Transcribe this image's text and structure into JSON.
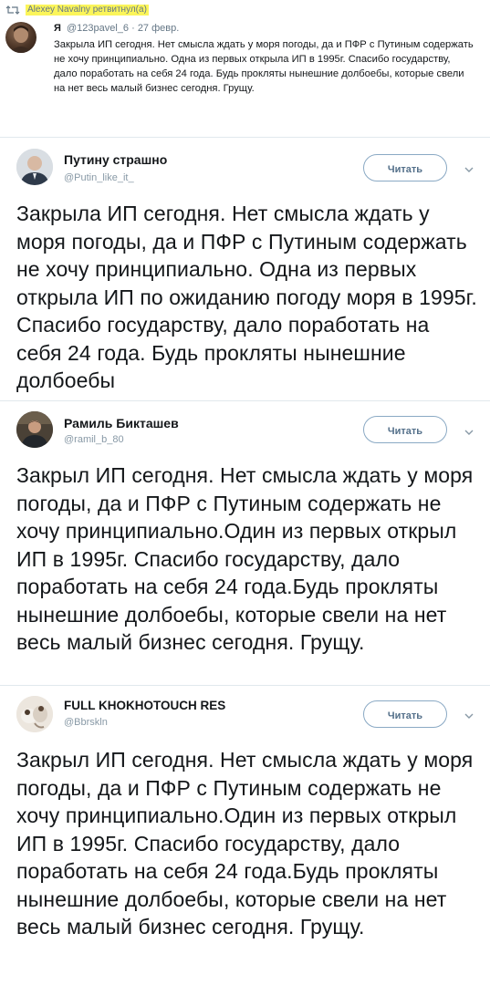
{
  "retweet": {
    "retweeted_by_label": "Alexey Navalny ретвитнул(а)",
    "author_name": "Я",
    "author_handle": "@123pavel_6",
    "date": "· 27 февр.",
    "text": "Закрыла ИП сегодня. Нет смысла ждать у моря погоды, да и ПФР с Путиным содержать не хочу принципиально. Одна из первых открыла ИП в 1995г. Спасибо государству, дало поработать на себя 24 года. Будь прокляты нынешние долбоебы, которые свели на нет весь малый бизнес сегодня. Грущу."
  },
  "tweets": [
    {
      "name": "Путину страшно",
      "handle": "@Putin_like_it_",
      "follow_label": "Читать",
      "text": "Закрыла ИП сегодня. Нет смысла ждать у моря погоды, да и ПФР с Путиным содержать не хочу принципиально. Одна из первых открыла ИП по ожиданию погоду моря в 1995г. Спасибо государству, дало поработать на себя 24 года. Будь прокляты нынешние долбоебы"
    },
    {
      "name": "Рамиль Бикташев",
      "handle": "@ramil_b_80",
      "follow_label": "Читать",
      "text": "Закрыл ИП сегодня. Нет смысла ждать у моря погоды, да и ПФР с Путиным содержать не хочу принципиально.Один из первых открыл ИП в 1995г.  Спасибо государству, дало поработать на себя 24 года.Будь прокляты  нынешние долбоебы, которые свели на нет весь малый бизнес сегодня.  Грущу."
    },
    {
      "name": "FULL KHOKHOTOUCH RES",
      "handle": "@Bbrskln",
      "follow_label": "Читать",
      "text": "Закрыл ИП сегодня. Нет смысла ждать у моря погоды, да и ПФР с Путиным содержать не хочу принципиально.Один из первых открыл ИП в 1995г.  Спасибо государству, дало поработать на себя 24 года.Будь прокляты  нынешние долбоебы, которые свели на нет весь малый бизнес сегодня.  Грущу."
    }
  ],
  "icons": {
    "retweet": "retweet-icon",
    "chevron": "chevron-down-icon"
  },
  "colors": {
    "highlight": "#fbf55a",
    "follow_border": "#8aa9c4",
    "follow_text": "#54708a",
    "muted_text": "#657786",
    "divider": "#e1e8ed"
  }
}
